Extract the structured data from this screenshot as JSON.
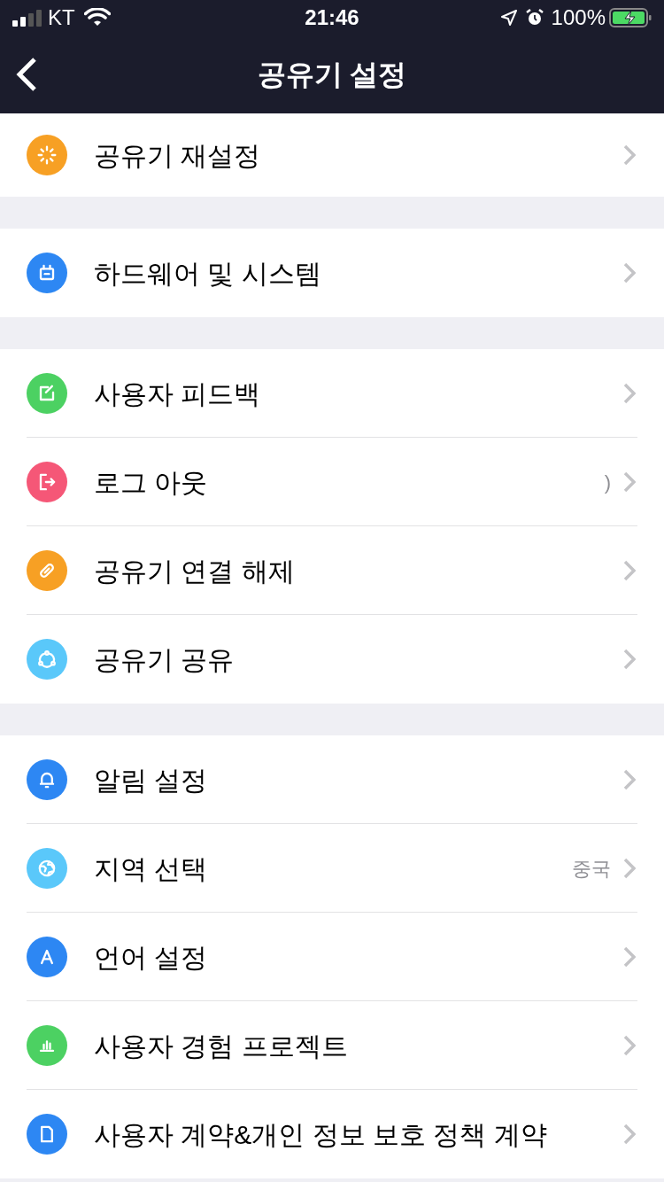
{
  "status_bar": {
    "carrier": "KT",
    "time": "21:46",
    "battery": "100%"
  },
  "header": {
    "title": "공유기 설정"
  },
  "groups": [
    {
      "items": [
        {
          "label": "공유기 재설정"
        }
      ]
    },
    {
      "items": [
        {
          "label": "하드웨어 및 시스템"
        }
      ]
    },
    {
      "items": [
        {
          "label": "사용자 피드백"
        },
        {
          "label": "로그 아웃",
          "value": ")"
        },
        {
          "label": "공유기 연결 해제"
        },
        {
          "label": "공유기 공유"
        }
      ]
    },
    {
      "items": [
        {
          "label": "알림 설정"
        },
        {
          "label": "지역 선택",
          "value": "중국"
        },
        {
          "label": "언어 설정"
        },
        {
          "label": "사용자 경험 프로젝트"
        },
        {
          "label": "사용자 계약&개인 정보 보호 정책 계약"
        }
      ]
    }
  ]
}
